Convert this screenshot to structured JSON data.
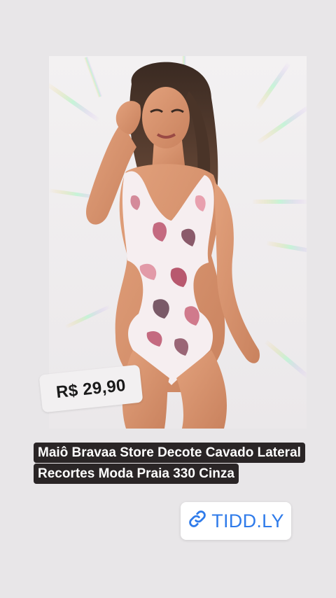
{
  "story": {
    "background_color": "#e8e6e8"
  },
  "product": {
    "image_description": "model wearing floral one-piece swimsuit",
    "price": "R$ 29,90",
    "title": "Maiô Bravaa Store Decote Cavado Lateral Recortes Moda Praia 330 Cinza"
  },
  "link_sticker": {
    "label": "TIDD.LY",
    "icon": "link-icon",
    "color": "#2f7bea"
  }
}
